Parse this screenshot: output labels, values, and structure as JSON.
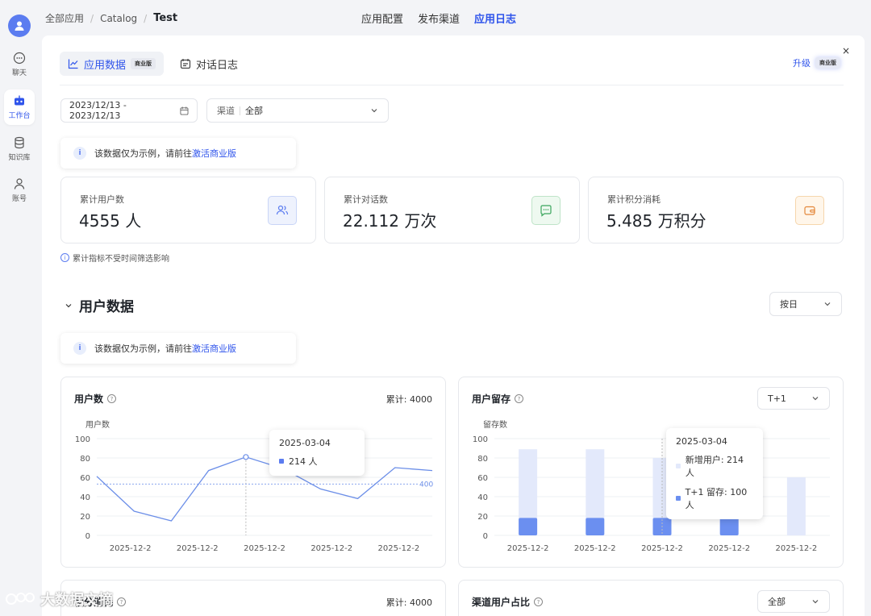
{
  "breadcrumb": {
    "root": "全部应用",
    "middle": "Catalog",
    "current": "Test"
  },
  "top_tabs": [
    {
      "label": "应用配置"
    },
    {
      "label": "发布渠道"
    },
    {
      "label": "应用日志"
    }
  ],
  "sidebar": {
    "items": [
      {
        "label": "聊天",
        "icon": "chat-icon"
      },
      {
        "label": "工作台",
        "icon": "robot-icon"
      },
      {
        "label": "知识库",
        "icon": "database-icon"
      },
      {
        "label": "账号",
        "icon": "user-icon"
      }
    ]
  },
  "panel": {
    "close": "×",
    "tab_data": "应用数据",
    "tab_data_badge": "商业版",
    "tab_log": "对话日志",
    "upgrade": "升级",
    "upgrade_badge": "商业版"
  },
  "filters": {
    "date_range": "2023/12/13 - 2023/12/13",
    "channel_label": "渠道",
    "channel_value": "全部"
  },
  "notice": {
    "text": "该数据仅为示例，请前往",
    "link": "激活商业版",
    "icon": "i"
  },
  "stats": [
    {
      "label": "累计用户数",
      "value": "4555 人"
    },
    {
      "label": "累计对话数",
      "value": "22.112 万次"
    },
    {
      "label": "累计积分消耗",
      "value": "5.485 万积分"
    }
  ],
  "hint": "累计指标不受时间筛选影响",
  "user_section": {
    "title": "用户数据",
    "period": "按日"
  },
  "cards": {
    "users": {
      "title": "用户数",
      "total_label": "累计: ",
      "total": "4000"
    },
    "retention": {
      "title": "用户留存",
      "select": "T+1"
    },
    "points": {
      "title": "积分消耗",
      "total_label": "累计: ",
      "total": "4000"
    },
    "channel": {
      "title": "渠道用户占比",
      "select": "全部"
    }
  },
  "tooltips": {
    "users": {
      "date": "2025-03-04",
      "value": "214 人"
    },
    "retention": {
      "date": "2025-03-04",
      "new_label": "新增用户: 214 人",
      "retain_label": "T+1 留存: 100 人"
    }
  },
  "chart_data": [
    {
      "type": "line",
      "ylabel": "用户数",
      "ylim": [
        0,
        100
      ],
      "yticks": [
        0,
        20,
        40,
        60,
        80,
        100
      ],
      "categories": [
        "2025-12-2",
        "2025-12-2",
        "2025-12-2",
        "2025-12-2",
        "2025-12-2"
      ],
      "values": [
        61,
        25,
        15,
        67,
        81,
        69,
        48,
        38,
        70,
        67
      ],
      "reference_line": {
        "value": 53,
        "label": "400"
      },
      "highlight_index": 4,
      "color": "#6b8ee8"
    },
    {
      "type": "bar",
      "ylabel": "留存数",
      "ylim": [
        0,
        100
      ],
      "yticks": [
        0,
        20,
        40,
        60,
        80,
        100
      ],
      "categories": [
        "2025-12-2",
        "2025-12-2",
        "2025-12-2",
        "2025-12-2",
        "2025-12-2"
      ],
      "series": [
        {
          "name": "新增用户",
          "values": [
            89,
            89,
            80,
            73,
            60
          ],
          "color": "#e3e9fb"
        },
        {
          "name": "T+1 留存",
          "values": [
            18,
            18,
            18,
            40,
            0
          ],
          "color": "#6b8ff0"
        }
      ],
      "highlight_index": 2
    }
  ],
  "watermark": "大数据文摘",
  "colors": {
    "accent": "#2f54eb",
    "green_icon": "#3aa55c",
    "orange_icon": "#e3873a",
    "blue_icon": "#5b7cf0"
  }
}
